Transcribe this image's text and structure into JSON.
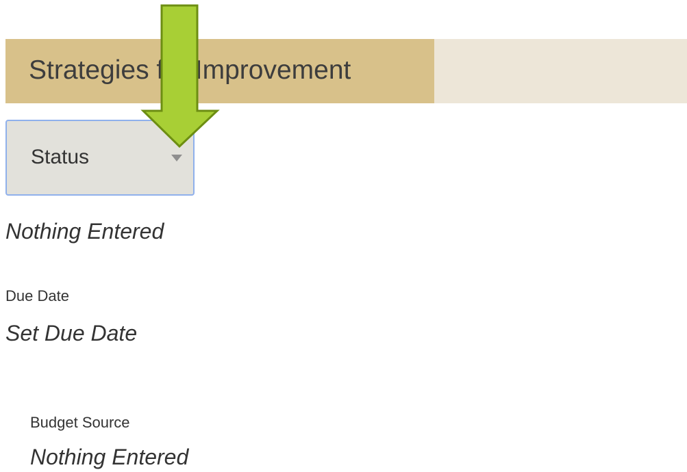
{
  "header": {
    "title": "Strategies for Improvement"
  },
  "status": {
    "label": "Status",
    "value": "Nothing Entered"
  },
  "due_date": {
    "label": "Due Date",
    "value": "Set Due Date"
  },
  "budget_source": {
    "label": "Budget Source",
    "value": "Nothing Entered"
  },
  "colors": {
    "header_tab": "#d8c18a",
    "header_band": "#ede6d8",
    "select_background": "#e2e1db",
    "select_border": "#8fb0ec",
    "arrow_fill": "#a8cf35",
    "arrow_stroke": "#6d8e12"
  },
  "icons": {
    "dropdown": "caret-down-icon",
    "annotation": "arrow-down-icon"
  }
}
